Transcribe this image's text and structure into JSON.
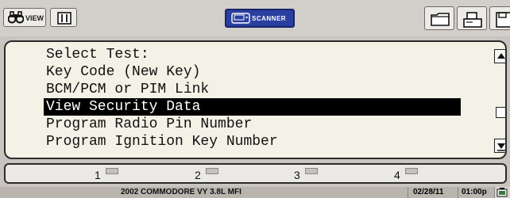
{
  "toolbar": {
    "view_label": "VIEW",
    "scanner_label": "SCANNER"
  },
  "menu": {
    "items": [
      "Select Test:",
      "Key Code (New Key)",
      "BCM/PCM or PIM Link",
      "View Security Data",
      "Program Radio Pin Number",
      "Program Ignition Key Number"
    ],
    "selected_index": 3
  },
  "tabs": [
    "1",
    "2",
    "3",
    "4"
  ],
  "status": {
    "vehicle": "2002  COMMODORE VY 3.8L MFI",
    "date": "02/28/11",
    "time": "01:00p"
  },
  "colors": {
    "panel_bg": "#f4f1e6",
    "selection_bg": "#000000",
    "scanner_btn": "#2a3fa0",
    "toolbar_bg": "#d2cec9",
    "status_bg": "#b9b4ae"
  },
  "icons": [
    "binoculars-icon",
    "split-screen-icon",
    "scanner-device-icon",
    "folder-icon",
    "print-icon",
    "save-icon",
    "scroll-up-arrow-icon",
    "scroll-down-arrow-icon",
    "battery-icon"
  ]
}
